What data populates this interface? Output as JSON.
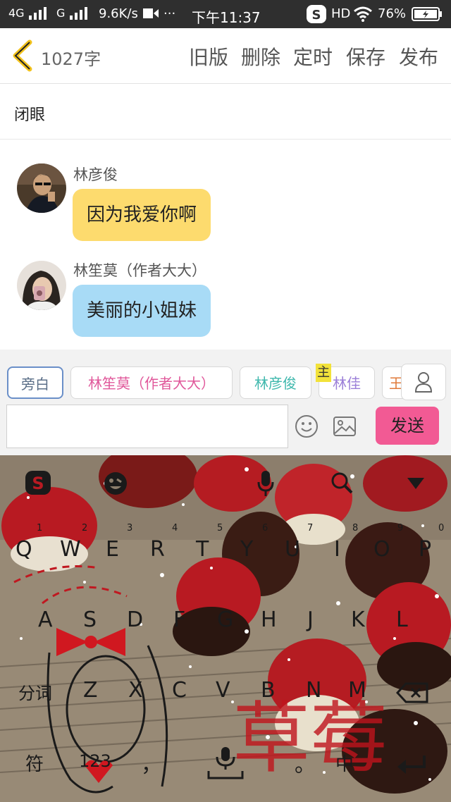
{
  "status_bar": {
    "network1": "4G",
    "network2": "G",
    "speed": "9.6K/s",
    "dots": "···",
    "time": "下午11:37",
    "hd": "HD",
    "battery": "76%"
  },
  "header": {
    "word_count": "1027字",
    "actions": [
      "旧版",
      "删除",
      "定时",
      "保存",
      "发布"
    ]
  },
  "title": "闭眼",
  "messages": [
    {
      "name": "林彦俊",
      "text": "因为我爱你啊",
      "color": "#fddb6e"
    },
    {
      "name": "林笙莫（作者大大）",
      "text": "美丽的小姐妹",
      "color": "#a8dbf6"
    }
  ],
  "roles": [
    {
      "label": "旁白",
      "color": "#5b6f88"
    },
    {
      "label": "林笙莫（作者大大）",
      "color": "#e0579a"
    },
    {
      "label": "林彦俊",
      "color": "#3fb8ad"
    },
    {
      "label": "林佳",
      "color": "#9b7fd8"
    }
  ],
  "main_badge": "主",
  "send_label": "发送",
  "keyboard": {
    "row1": [
      "Q",
      "W",
      "E",
      "R",
      "T",
      "Y",
      "U",
      "I",
      "O",
      "P"
    ],
    "row1_hints": [
      "1",
      "2",
      "3",
      "4",
      "5",
      "6",
      "7",
      "8",
      "9",
      "0"
    ],
    "row2": [
      "A",
      "S",
      "D",
      "F",
      "G",
      "H",
      "J",
      "K",
      "L"
    ],
    "row3_left": "分词",
    "row3": [
      "Z",
      "X",
      "C",
      "V",
      "B",
      "N",
      "M"
    ],
    "row4_left": "符",
    "row4_num": "123",
    "row4_comma": "，",
    "row4_period": "。",
    "row4_lang": "中",
    "deco_text": "草莓"
  },
  "colors": {
    "accent_back": "#f2c21c",
    "send_bg": "#f25a94",
    "bubble_yellow": "#fddb6e",
    "bubble_blue": "#a8dbf6"
  }
}
